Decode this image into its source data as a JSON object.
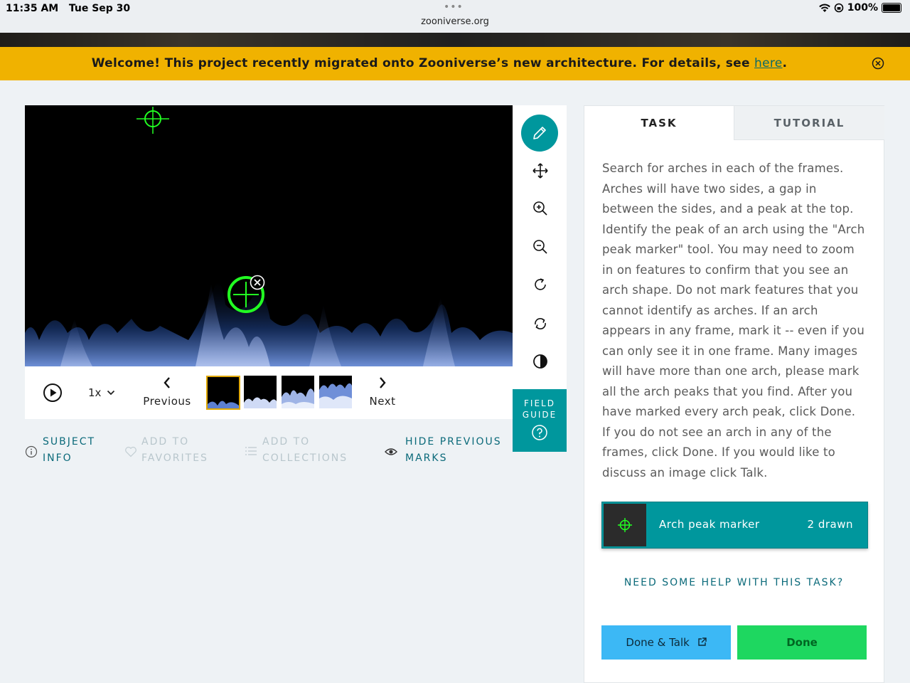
{
  "status_bar": {
    "time": "11:35 AM",
    "date": "Tue Sep 30",
    "url": "zooniverse.org",
    "battery": "100%"
  },
  "banner": {
    "text": "Welcome! This project recently migrated onto Zooniverse’s new architecture. For details, see ",
    "link": "here",
    "end": "."
  },
  "viewer": {
    "speed": "1x",
    "previous": "Previous",
    "next": "Next",
    "frame_count": 4,
    "active_frame": 1
  },
  "field_guide": {
    "line1": "FIELD",
    "line2": "GUIDE"
  },
  "meta": {
    "subject_info_1": "SUBJECT",
    "subject_info_2": "INFO",
    "favorites_1": "ADD TO",
    "favorites_2": "FAVORITES",
    "collections_1": "ADD TO",
    "collections_2": "COLLECTIONS",
    "hide_1": "HIDE PREVIOUS",
    "hide_2": "MARKS"
  },
  "task_panel": {
    "tab_task": "TASK",
    "tab_tutorial": "TUTORIAL",
    "instructions": "Search for arches in each of the frames. Arches will have two sides, a gap in between the sides, and a peak at the top. Identify the peak of an arch using the \"Arch peak marker\" tool. You may need to zoom in on features to confirm that you see an arch shape. Do not mark features that you cannot identify as arches. If an arch appears in any frame, mark it -- even if you can only see it in one frame. Many images will have more than one arch, please mark all the arch peaks that you find. After you have marked every arch peak, click Done. If you do not see an arch in any of the frames, click Done. If you would like to discuss an image click Talk.",
    "tool_label": "Arch peak marker",
    "tool_count": "2 drawn",
    "help": "NEED SOME HELP WITH THIS TASK?",
    "done_talk": "Done & Talk",
    "done": "Done"
  },
  "colors": {
    "teal": "#00979d",
    "banner": "#f0b200",
    "marker": "#22ff22",
    "done": "#1ed760",
    "talk": "#3cb8f5"
  }
}
